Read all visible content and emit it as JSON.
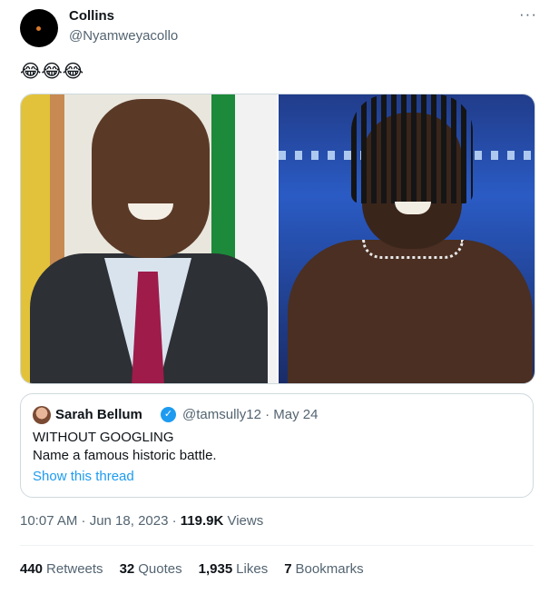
{
  "author": {
    "name": "Collins",
    "handle": "@Nyamweyacollo"
  },
  "more_label": "···",
  "tweet_text": "😂😂😂",
  "media": {
    "left_alt": "Smiling man in suit",
    "right_alt": "Smiling wrestler with dreadlocks"
  },
  "quote": {
    "name": "Sarah Bellum",
    "verified_label": "✓",
    "meta": "@tamsully12 · May 24",
    "line1": "WITHOUT GOOGLING",
    "line2": "Name a famous historic battle.",
    "show_thread": "Show this thread"
  },
  "timestamp": {
    "time": "10:07 AM · Jun 18, 2023 · ",
    "views": "119.9K",
    "views_label": " Views"
  },
  "stats": [
    {
      "value": "440",
      "label": "Retweets"
    },
    {
      "value": "32",
      "label": "Quotes"
    },
    {
      "value": "1,935",
      "label": "Likes"
    },
    {
      "value": "7",
      "label": "Bookmarks"
    }
  ]
}
